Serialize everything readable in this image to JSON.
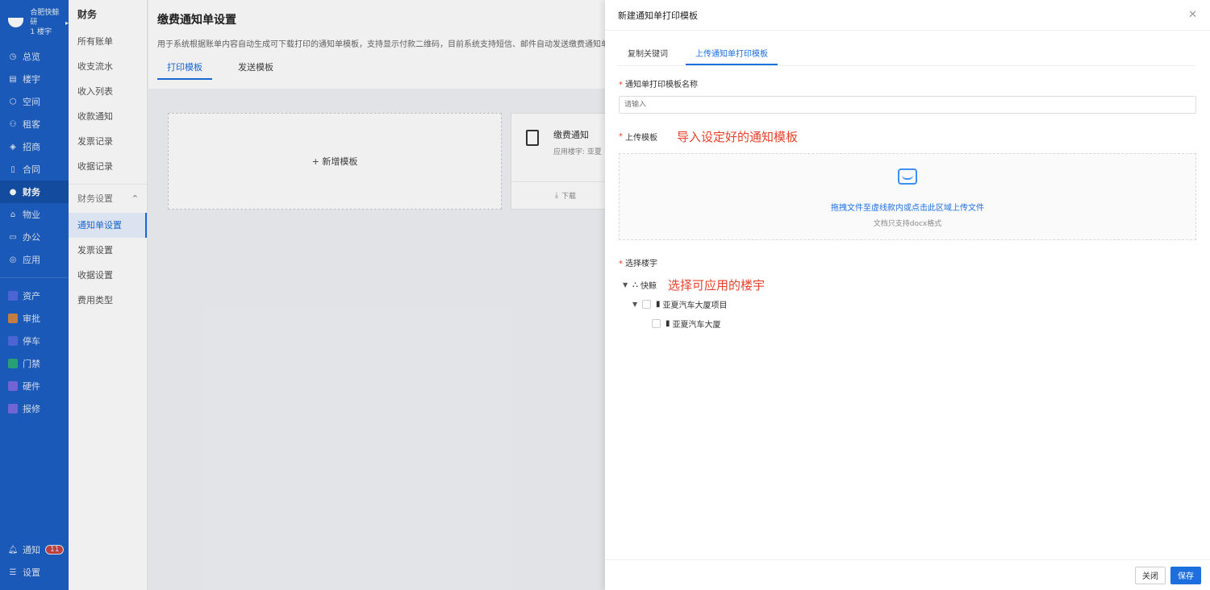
{
  "sidebar": {
    "brand_line1": "合肥快鲸研",
    "brand_line2": "1 楼宇",
    "items": [
      {
        "label": "总览",
        "icon": "clock-icon"
      },
      {
        "label": "楼宇",
        "icon": "building-icon"
      },
      {
        "label": "空间",
        "icon": "cube-icon"
      },
      {
        "label": "租客",
        "icon": "users-icon"
      },
      {
        "label": "招商",
        "icon": "tag-icon"
      },
      {
        "label": "合同",
        "icon": "document-icon"
      },
      {
        "label": "财务",
        "icon": "finance-icon"
      },
      {
        "label": "物业",
        "icon": "house-icon"
      },
      {
        "label": "办公",
        "icon": "monitor-icon"
      },
      {
        "label": "应用",
        "icon": "app-icon"
      }
    ],
    "apps": [
      {
        "label": "资产",
        "color": "#5b6ee8"
      },
      {
        "label": "审批",
        "color": "#f08c2e"
      },
      {
        "label": "停车",
        "color": "#5b6ee8"
      },
      {
        "label": "门禁",
        "color": "#2eb872"
      },
      {
        "label": "硬件",
        "color": "#8a6ee8"
      },
      {
        "label": "报修",
        "color": "#8a6ee8"
      }
    ],
    "notify_label": "通知",
    "notify_count": "11",
    "settings_label": "设置"
  },
  "subnav": {
    "title": "财务",
    "items": [
      "所有账单",
      "收支流水",
      "收入列表",
      "收款通知",
      "发票记录",
      "收据记录"
    ],
    "group_label": "财务设置",
    "group_items": [
      "通知单设置",
      "发票设置",
      "收据设置",
      "费用类型"
    ]
  },
  "main": {
    "title": "缴费通知单设置",
    "description": "用于系统根据账单内容自动生成可下载打印的通知单模板，支持显示付款二维码，目前系统支持短信、邮件自动发送缴费通知单，",
    "tabs": [
      "打印模板",
      "发送模板"
    ],
    "add_template_label": "+ 新增模板",
    "template_card": {
      "title": "缴费通知",
      "subtitle": "应用楼宇: 亚夏",
      "download_label": "下载"
    }
  },
  "drawer": {
    "title": "新建通知单打印模板",
    "tabs": [
      "复制关键词",
      "上传通知单打印模板"
    ],
    "name_label": "通知单打印模板名称",
    "name_placeholder": "请输入",
    "upload_label": "上传模板",
    "upload_annotation": "导入设定好的通知模板",
    "upload_main_text": "拖拽文件至虚线款内或点击此区域上传文件",
    "upload_hint": "文档只支持docx格式",
    "building_label": "选择楼宇",
    "building_annotation": "选择可应用的楼宇",
    "tree": {
      "root": "快鲸",
      "project": "亚夏汽车大厦项目",
      "building": "亚夏汽车大厦"
    },
    "close_button": "关闭",
    "save_button": "保存"
  }
}
